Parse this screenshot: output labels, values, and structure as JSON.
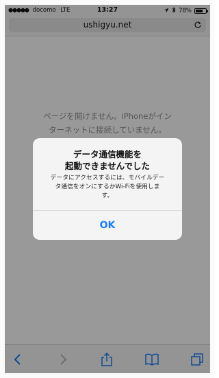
{
  "status_bar": {
    "carrier": "docomo",
    "network": "LTE",
    "time": "13:27",
    "battery": "78%",
    "battery_level": 0.78
  },
  "browser": {
    "url": "ushigyu.net",
    "reload_icon": "reload-icon"
  },
  "page": {
    "error_message_line1": "ページを開けません。iPhoneがイン",
    "error_message_line2": "ターネットに接続していません。"
  },
  "alert": {
    "title_line1": "データ通信機能を",
    "title_line2": "起動できませんでした",
    "message_line1": "データにアクセスするには、モバイルデー",
    "message_line2": "タ通信をオンにするかWi-Fiを使用しま",
    "message_line3": "す。",
    "ok_label": "OK"
  },
  "toolbar": {
    "items": [
      "back-icon",
      "forward-icon",
      "share-icon",
      "bookmarks-icon",
      "tabs-icon"
    ]
  },
  "colors": {
    "accent": "#1a7ef5",
    "overlay": "rgba(0,0,0,0.40)"
  }
}
